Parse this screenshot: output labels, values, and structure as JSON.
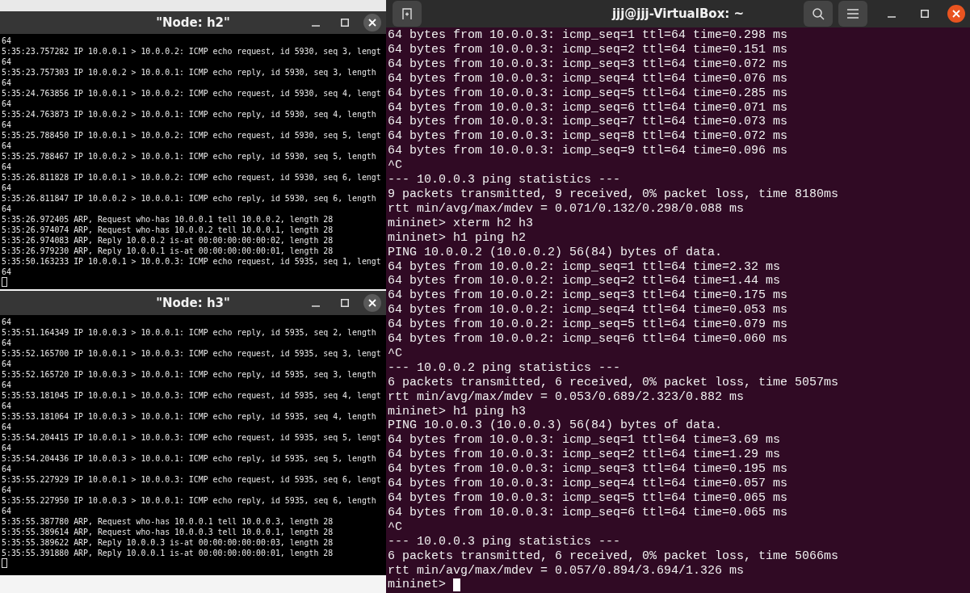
{
  "xterms": [
    {
      "title": "\"Node: h2\"",
      "cursor": true,
      "lines": [
        "64",
        "5:35:23.757282 IP 10.0.0.1 > 10.0.0.2: ICMP echo request, id 5930, seq 3, lengt",
        "64",
        "5:35:23.757303 IP 10.0.0.2 > 10.0.0.1: ICMP echo reply, id 5930, seq 3, length",
        "64",
        "5:35:24.763856 IP 10.0.0.1 > 10.0.0.2: ICMP echo request, id 5930, seq 4, lengt",
        "64",
        "5:35:24.763873 IP 10.0.0.2 > 10.0.0.1: ICMP echo reply, id 5930, seq 4, length",
        "64",
        "5:35:25.788450 IP 10.0.0.1 > 10.0.0.2: ICMP echo request, id 5930, seq 5, lengt",
        "64",
        "5:35:25.788467 IP 10.0.0.2 > 10.0.0.1: ICMP echo reply, id 5930, seq 5, length",
        "64",
        "5:35:26.811828 IP 10.0.0.1 > 10.0.0.2: ICMP echo request, id 5930, seq 6, lengt",
        "64",
        "5:35:26.811847 IP 10.0.0.2 > 10.0.0.1: ICMP echo reply, id 5930, seq 6, length",
        "64",
        "5:35:26.972405 ARP, Request who-has 10.0.0.1 tell 10.0.0.2, length 28",
        "5:35:26.974074 ARP, Request who-has 10.0.0.2 tell 10.0.0.1, length 28",
        "5:35:26.974083 ARP, Reply 10.0.0.2 is-at 00:00:00:00:00:02, length 28",
        "5:35:26.979230 ARP, Reply 10.0.0.1 is-at 00:00:00:00:00:01, length 28",
        "5:35:50.163233 IP 10.0.0.1 > 10.0.0.3: ICMP echo request, id 5935, seq 1, lengt",
        "64"
      ]
    },
    {
      "title": "\"Node: h3\"",
      "cursor": true,
      "lines": [
        "64",
        "5:35:51.164349 IP 10.0.0.3 > 10.0.0.1: ICMP echo reply, id 5935, seq 2, length",
        "64",
        "5:35:52.165700 IP 10.0.0.1 > 10.0.0.3: ICMP echo request, id 5935, seq 3, lengt",
        "64",
        "5:35:52.165720 IP 10.0.0.3 > 10.0.0.1: ICMP echo reply, id 5935, seq 3, length",
        "64",
        "5:35:53.181045 IP 10.0.0.1 > 10.0.0.3: ICMP echo request, id 5935, seq 4, lengt",
        "64",
        "5:35:53.181064 IP 10.0.0.3 > 10.0.0.1: ICMP echo reply, id 5935, seq 4, length",
        "64",
        "5:35:54.204415 IP 10.0.0.1 > 10.0.0.3: ICMP echo request, id 5935, seq 5, lengt",
        "64",
        "5:35:54.204436 IP 10.0.0.3 > 10.0.0.1: ICMP echo reply, id 5935, seq 5, length",
        "64",
        "5:35:55.227929 IP 10.0.0.1 > 10.0.0.3: ICMP echo request, id 5935, seq 6, lengt",
        "64",
        "5:35:55.227950 IP 10.0.0.3 > 10.0.0.1: ICMP echo reply, id 5935, seq 6, length",
        "64",
        "5:35:55.387780 ARP, Request who-has 10.0.0.1 tell 10.0.0.3, length 28",
        "5:35:55.389614 ARP, Request who-has 10.0.0.3 tell 10.0.0.1, length 28",
        "5:35:55.389622 ARP, Reply 10.0.0.3 is-at 00:00:00:00:00:03, length 28",
        "5:35:55.391880 ARP, Reply 10.0.0.1 is-at 00:00:00:00:00:01, length 28"
      ]
    }
  ],
  "terminal": {
    "title": "jjj@jjj-VirtualBox: ~",
    "cursor": true,
    "lines": [
      "64 bytes from 10.0.0.3: icmp_seq=1 ttl=64 time=0.298 ms",
      "64 bytes from 10.0.0.3: icmp_seq=2 ttl=64 time=0.151 ms",
      "64 bytes from 10.0.0.3: icmp_seq=3 ttl=64 time=0.072 ms",
      "64 bytes from 10.0.0.3: icmp_seq=4 ttl=64 time=0.076 ms",
      "64 bytes from 10.0.0.3: icmp_seq=5 ttl=64 time=0.285 ms",
      "64 bytes from 10.0.0.3: icmp_seq=6 ttl=64 time=0.071 ms",
      "64 bytes from 10.0.0.3: icmp_seq=7 ttl=64 time=0.073 ms",
      "64 bytes from 10.0.0.3: icmp_seq=8 ttl=64 time=0.072 ms",
      "64 bytes from 10.0.0.3: icmp_seq=9 ttl=64 time=0.096 ms",
      "^C",
      "--- 10.0.0.3 ping statistics ---",
      "9 packets transmitted, 9 received, 0% packet loss, time 8180ms",
      "rtt min/avg/max/mdev = 0.071/0.132/0.298/0.088 ms",
      "mininet> xterm h2 h3",
      "mininet> h1 ping h2",
      "PING 10.0.0.2 (10.0.0.2) 56(84) bytes of data.",
      "64 bytes from 10.0.0.2: icmp_seq=1 ttl=64 time=2.32 ms",
      "64 bytes from 10.0.0.2: icmp_seq=2 ttl=64 time=1.44 ms",
      "64 bytes from 10.0.0.2: icmp_seq=3 ttl=64 time=0.175 ms",
      "64 bytes from 10.0.0.2: icmp_seq=4 ttl=64 time=0.053 ms",
      "64 bytes from 10.0.0.2: icmp_seq=5 ttl=64 time=0.079 ms",
      "64 bytes from 10.0.0.2: icmp_seq=6 ttl=64 time=0.060 ms",
      "^C",
      "--- 10.0.0.2 ping statistics ---",
      "6 packets transmitted, 6 received, 0% packet loss, time 5057ms",
      "rtt min/avg/max/mdev = 0.053/0.689/2.323/0.882 ms",
      "mininet> h1 ping h3",
      "PING 10.0.0.3 (10.0.0.3) 56(84) bytes of data.",
      "64 bytes from 10.0.0.3: icmp_seq=1 ttl=64 time=3.69 ms",
      "64 bytes from 10.0.0.3: icmp_seq=2 ttl=64 time=1.29 ms",
      "64 bytes from 10.0.0.3: icmp_seq=3 ttl=64 time=0.195 ms",
      "64 bytes from 10.0.0.3: icmp_seq=4 ttl=64 time=0.057 ms",
      "64 bytes from 10.0.0.3: icmp_seq=5 ttl=64 time=0.065 ms",
      "64 bytes from 10.0.0.3: icmp_seq=6 ttl=64 time=0.065 ms",
      "^C",
      "--- 10.0.0.3 ping statistics ---",
      "6 packets transmitted, 6 received, 0% packet loss, time 5066ms",
      "rtt min/avg/max/mdev = 0.057/0.894/3.694/1.326 ms",
      "mininet>"
    ]
  }
}
